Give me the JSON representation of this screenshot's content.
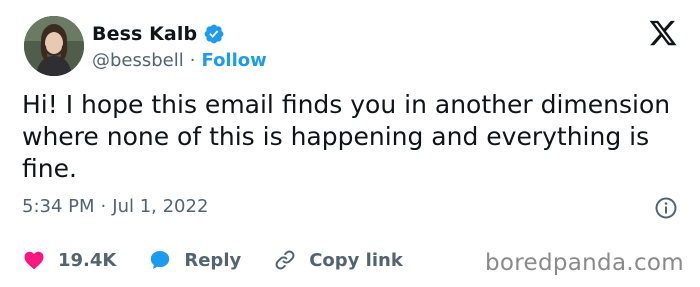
{
  "author": {
    "name": "Bess Kalb",
    "handle": "@bessbell",
    "separator": "·",
    "follow_label": "Follow"
  },
  "tweet": {
    "text": "Hi! I hope this email finds you in another dimension where none of this is happening and everything is fine.",
    "time": "5:34 PM",
    "date_separator": "·",
    "date": "Jul 1, 2022"
  },
  "actions": {
    "likes": "19.4K",
    "reply_label": "Reply",
    "copy_link_label": "Copy link"
  },
  "watermark": "boredpanda.com",
  "colors": {
    "accent": "#1d9bf0",
    "like": "#f91880",
    "text": "#0f1419",
    "muted": "#536471"
  },
  "icons": [
    "verified-badge-icon",
    "x-logo-icon",
    "info-icon",
    "heart-icon",
    "reply-bubble-icon",
    "link-icon"
  ]
}
